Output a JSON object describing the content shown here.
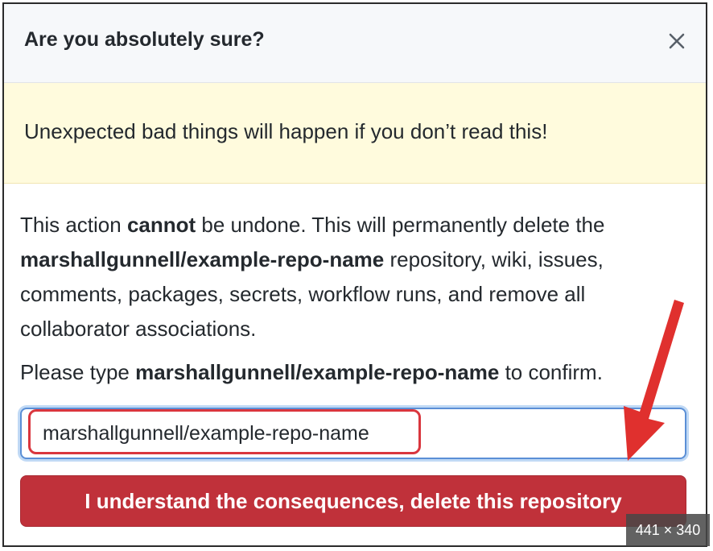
{
  "dialog": {
    "title": "Are you absolutely sure?",
    "close_icon": "close-icon",
    "warning": "Unexpected bad things will happen if you don’t read this!",
    "body": {
      "p1_a": "This action ",
      "p1_b": "cannot",
      "p1_c": " be undone. This will permanently delete the ",
      "p1_d": "marshallgunnell/example-repo-name",
      "p1_e": " repository, wiki, issues, comments, packages, secrets, workflow runs, and remove all collaborator associations."
    },
    "confirm": {
      "prefix": "Please type ",
      "repo": "marshallgunnell/example-repo-name",
      "suffix": " to confirm."
    },
    "input_value": "marshallgunnell/example-repo-name",
    "delete_button": "I understand the consequences, delete this repository"
  },
  "annotation": {
    "highlight_color": "#d9363e",
    "arrow_color": "#e0302e"
  },
  "overlay": {
    "size_badge": "441 × 340"
  }
}
